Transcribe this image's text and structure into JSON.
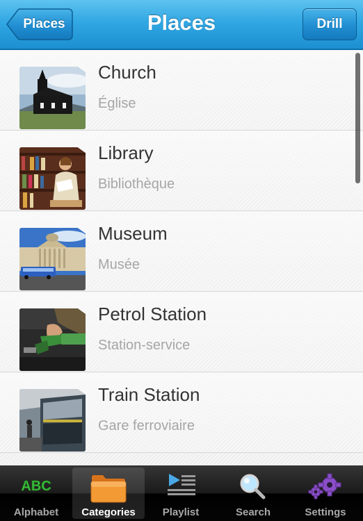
{
  "navbar": {
    "title": "Places",
    "back_label": "Places",
    "right_label": "Drill"
  },
  "items": [
    {
      "title": "Church",
      "subtitle": "Église",
      "image": "church-photo"
    },
    {
      "title": "Library",
      "subtitle": "Bibliothèque",
      "image": "library-photo"
    },
    {
      "title": "Museum",
      "subtitle": "Musée",
      "image": "museum-photo"
    },
    {
      "title": "Petrol Station",
      "subtitle": "Station-service",
      "image": "petrol-pump-photo"
    },
    {
      "title": "Train Station",
      "subtitle": "Gare ferroviaire",
      "image": "train-photo"
    }
  ],
  "tabs": [
    {
      "label": "Alphabet",
      "icon": "abc-icon",
      "icon_text": "ABC",
      "selected": false
    },
    {
      "label": "Categories",
      "icon": "folder-icon",
      "selected": true
    },
    {
      "label": "Playlist",
      "icon": "playlist-icon",
      "selected": false
    },
    {
      "label": "Search",
      "icon": "magnifier-icon",
      "selected": false
    },
    {
      "label": "Settings",
      "icon": "gears-icon",
      "selected": false
    }
  ],
  "colors": {
    "navbar": "#31a7e3",
    "abc_green": "#3fbf3f",
    "folder_orange": "#f08a24",
    "settings_purple": "#8a4fc8"
  }
}
